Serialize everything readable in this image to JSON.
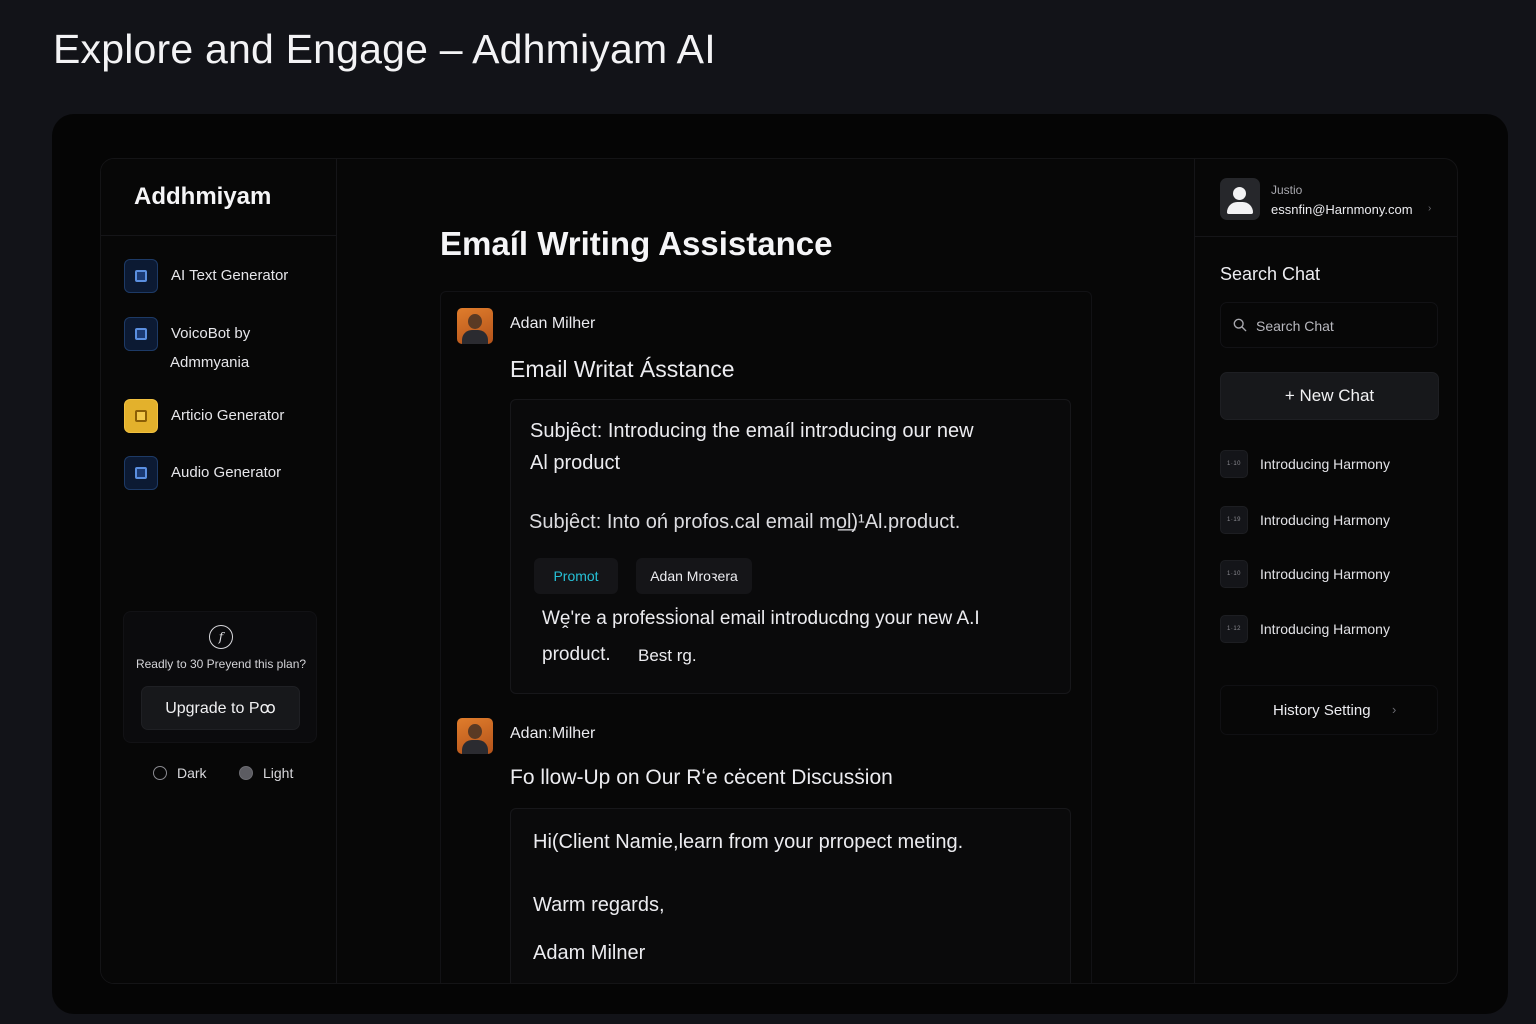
{
  "page": {
    "heading": "Explore and Engage – Adhmiyam AI"
  },
  "sidebar": {
    "brand": "Addhmiyam",
    "items": [
      {
        "label": "AI Text Generator",
        "icon": "doc-icon",
        "color": "#1b3a73"
      },
      {
        "label_line1": "VoicoBot by",
        "label_line2": "Admmyania",
        "icon": "voice-icon",
        "color": "#1b3a73"
      },
      {
        "label": "Articio Generator",
        "icon": "article-icon",
        "color": "#e3b12c"
      },
      {
        "label": "Audio Generator",
        "icon": "audio-icon",
        "color": "#1b3a73"
      }
    ],
    "upgrade": {
      "text": "Readly to 30 Preyend this plan?",
      "button": "Upgrade to Pꝏ"
    },
    "theme": {
      "dark": "Dark",
      "light": "Light",
      "selected": "Light"
    }
  },
  "main": {
    "title": "Emaíl Writing Assistance",
    "messages": [
      {
        "author": "Adan Milher",
        "heading": "Email Writat Ásstance",
        "subject_line1": "Subjȇct:  Introducing the emaíl intrᴐducing our new",
        "subject_line2": "Al product",
        "subject2": "Subjȇct:  Into oń profos.cal  email mo͟l)¹Al.product.",
        "chip_accent": "Promot",
        "chip_plain": "Adan Mroꝛera",
        "body_line1": "Wḙ're a professi̇onal email introducdng your new A.I",
        "body_line2_a": "product.",
        "body_line2_b": "Best rg."
      },
      {
        "author": "AdanːMilher",
        "heading": "Fo llow-Up on Our Rʻe cėcent Discusṡion",
        "line1": "Hi(Client Namie,learn from your prropect meting.",
        "line2": "Warm regards,",
        "line3": "Adam Milner"
      }
    ]
  },
  "right": {
    "user": {
      "name": "Justio",
      "email": "essnfin@Harnmony.com",
      "chevron": "›"
    },
    "search": {
      "title": "Search Chat",
      "placeholder": "Search Chat"
    },
    "new_chat": "+ New Chat",
    "history": [
      {
        "label": "Introducing Harmony",
        "badge": "1·10"
      },
      {
        "label": "Introducing Harmony",
        "badge": "1·19"
      },
      {
        "label": "Introducing Harmony",
        "badge": "1·10"
      },
      {
        "label": "Introducing Harmony",
        "badge": "1·12"
      }
    ],
    "history_setting": "History Setting",
    "history_setting_chevron": "›"
  },
  "colors": {
    "background": "#121318",
    "panel": "#070707",
    "accent_chip": "#26c0d6",
    "yellow_icon": "#e3b12c"
  }
}
